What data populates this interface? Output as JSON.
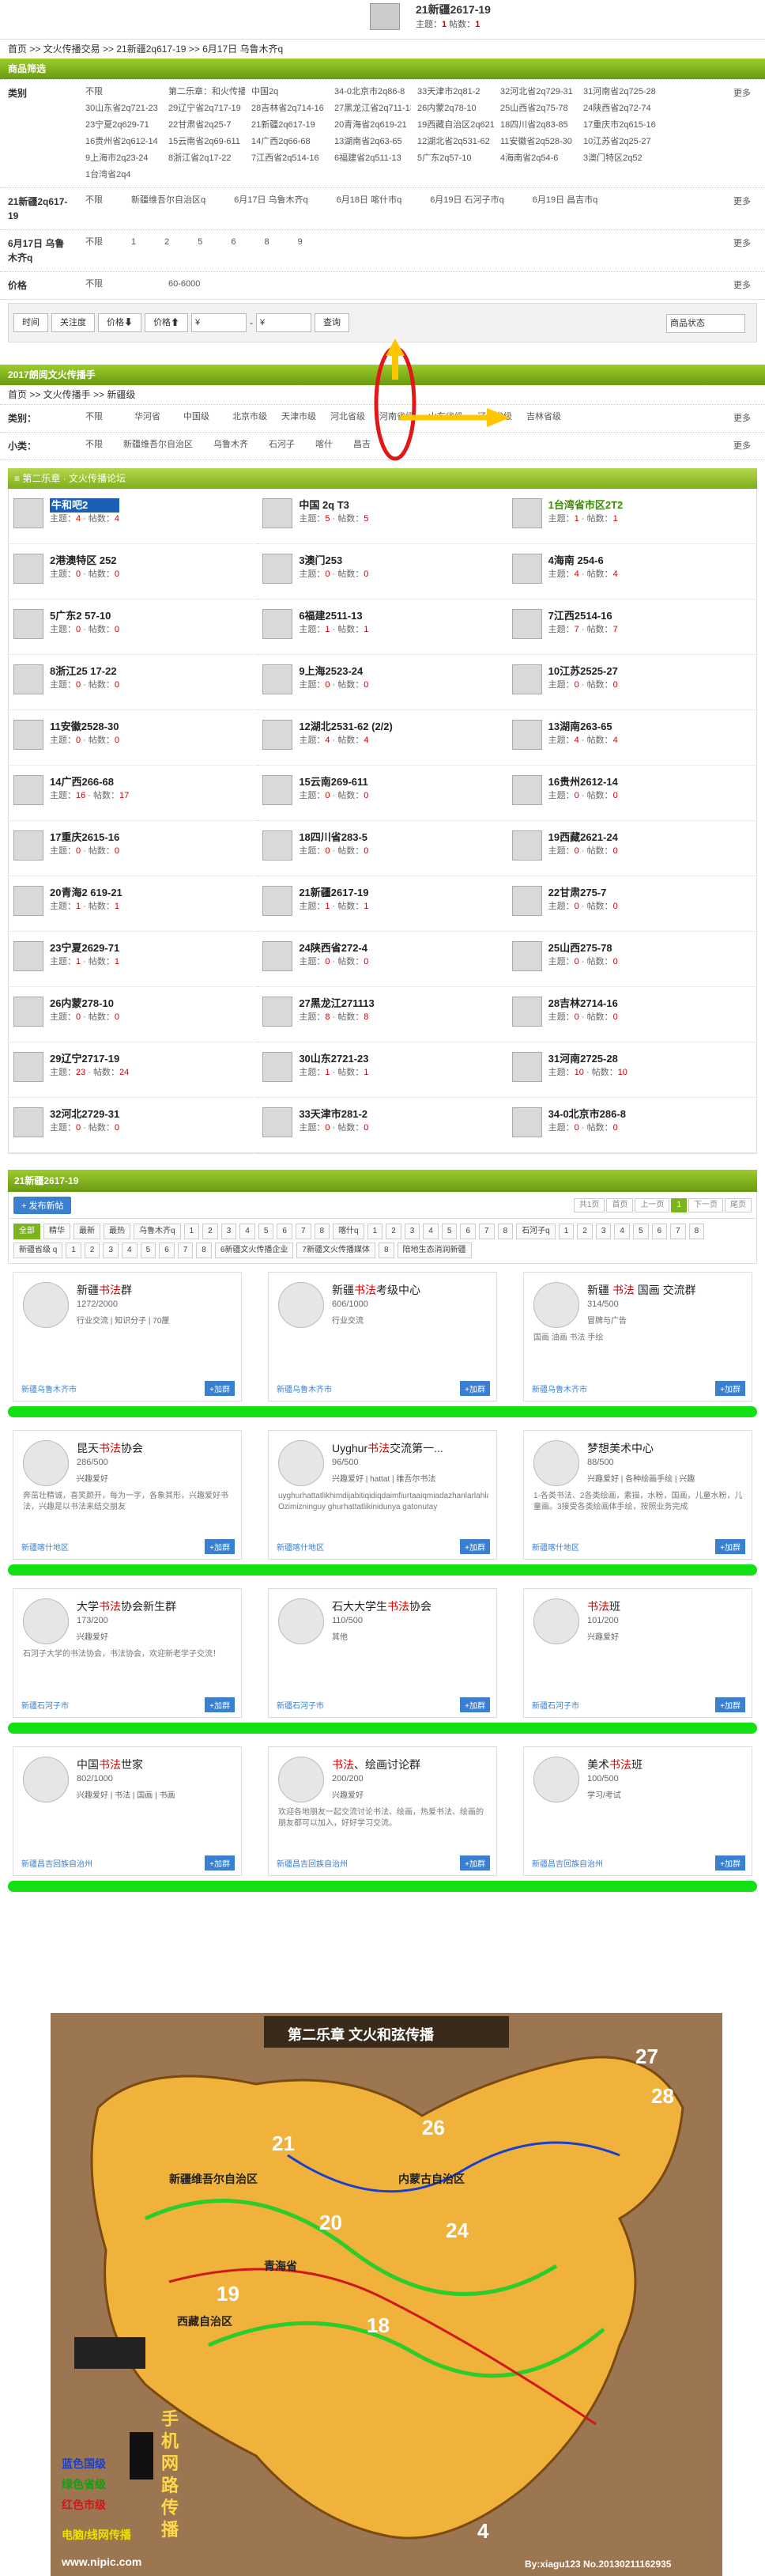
{
  "header": {
    "title": "21新疆2617-19",
    "stat_prefix": "主题：",
    "topics": "1",
    "stat_mid": " 帖数：",
    "posts": "1"
  },
  "breadcrumb": "首页 >> 文火传播交易 >> 21新疆2q617-19 >> 6月17日 乌鲁木齐q",
  "filter_title": "商品筛选",
  "filters": [
    {
      "label": "类别",
      "opts": [
        "不限",
        "第二乐章：和火传播",
        "中国2q",
        "34-0北京市2q86-8",
        "33天津市2q81-2",
        "32河北省2q729-31",
        "31河南省2q725-28",
        "30山东省2q721-23",
        "29辽宁省2q717-19",
        "28吉林省2q714-16",
        "27黑龙江省2q711-13",
        "26内蒙2q78-10",
        "25山西省2q75-78",
        "24陕西省2q72-74",
        "23宁夏2q629-71",
        "22甘肃省2q25-7",
        "21新疆2q617-19",
        "20青海省2q619-21",
        "19西藏自治区2q621-24",
        "18四川省2q83-85",
        "17重庆市2q615-16",
        "16贵州省2q612-14",
        "15云南省2q69-611",
        "14广西2q66-68",
        "13湖南省2q63-65",
        "12湖北省2q531-62",
        "11安徽省2q528-30",
        "10江苏省2q25-27",
        "9上海市2q23-24",
        "8浙江省2q17-22",
        "7江西省2q514-16",
        "6福建省2q511-13",
        "5广东2q57-10",
        "4海南省2q54-6",
        "3澳门特区2q52",
        "1台湾省2q4"
      ]
    },
    {
      "label": "21新疆2q617-19",
      "opts": [
        "不限",
        "新疆维吾尔自治区q",
        "6月17日 乌鲁木齐q",
        "6月18日 喀什市q",
        "6月19日 石河子市q",
        "6月19日 昌吉市q"
      ]
    },
    {
      "label": "6月17日 乌鲁木齐q",
      "opts": [
        "不限",
        "1",
        "2",
        "5",
        "6",
        "8",
        "9"
      ]
    },
    {
      "label": "价格",
      "opts": [
        "不限",
        "60-6000"
      ]
    }
  ],
  "more": "更多",
  "sort": {
    "time": "时间",
    "attention": "关注度",
    "price": "价格⬇",
    "price2": "价格⬆",
    "from": "¥",
    "to": "¥",
    "search": "查询",
    "status": "商品状态"
  },
  "spread_title": "2017朗阅文火传播手",
  "crumb2": "首页 >> 文火传播手 >> 新疆级",
  "cat_label": "类别：",
  "cat_opts": [
    "不限",
    "华河省",
    "中国级",
    "北京市级",
    "天津市级",
    "河北省级",
    "河南省级",
    "山东省级",
    "辽宁省级",
    "吉林省级"
  ],
  "sub_label": "小类：",
  "sub_opts": [
    "不限",
    "新疆维吾尔自治区",
    "乌鲁木齐",
    "石河子",
    "喀什",
    "昌吉"
  ],
  "forum_header": "≡ 第二乐章 · 文火传播论坛",
  "forums": [
    {
      "name": "牛和吧2",
      "t": "4",
      "p": "4",
      "hl": true
    },
    {
      "name": "中国 2q T3",
      "t": "5",
      "p": "5"
    },
    {
      "name": "1台湾省市区2T2",
      "t": "1",
      "p": "1",
      "g": true
    },
    {
      "name": "2港澳特区 252",
      "t": "0",
      "p": "0"
    },
    {
      "name": "3澳门253",
      "t": "0",
      "p": "0"
    },
    {
      "name": "4海南 254-6",
      "t": "4",
      "p": "4"
    },
    {
      "name": "5广东2 57-10",
      "t": "0",
      "p": "0"
    },
    {
      "name": "6福建2511-13",
      "t": "1",
      "p": "1"
    },
    {
      "name": "7江西2514-16",
      "t": "7",
      "p": "7"
    },
    {
      "name": "8浙江25 17-22",
      "t": "0",
      "p": "0"
    },
    {
      "name": "9上海2523-24",
      "t": "0",
      "p": "0"
    },
    {
      "name": "10江苏2525-27",
      "t": "0",
      "p": "0"
    },
    {
      "name": "11安徽2528-30",
      "t": "0",
      "p": "0"
    },
    {
      "name": "12湖北2531-62 (2/2)",
      "t": "4",
      "p": "4"
    },
    {
      "name": "13湖南263-65",
      "t": "4",
      "p": "4"
    },
    {
      "name": "14广西266-68",
      "t": "16",
      "p": "17"
    },
    {
      "name": "15云南269-611",
      "t": "0",
      "p": "0"
    },
    {
      "name": "16贵州2612-14",
      "t": "0",
      "p": "0"
    },
    {
      "name": "17重庆2615-16",
      "t": "0",
      "p": "0"
    },
    {
      "name": "18四川省283-5",
      "t": "0",
      "p": "0"
    },
    {
      "name": "19西藏2621-24",
      "t": "0",
      "p": "0"
    },
    {
      "name": "20青海2 619-21",
      "t": "1",
      "p": "1"
    },
    {
      "name": "21新疆2617-19",
      "t": "1",
      "p": "1"
    },
    {
      "name": "22甘肃275-7",
      "t": "0",
      "p": "0"
    },
    {
      "name": "23宁夏2629-71",
      "t": "1",
      "p": "1"
    },
    {
      "name": "24陕西省272-4",
      "t": "0",
      "p": "0"
    },
    {
      "name": "25山西275-78",
      "t": "0",
      "p": "0"
    },
    {
      "name": "26内蒙278-10",
      "t": "0",
      "p": "0"
    },
    {
      "name": "27黑龙江271113",
      "t": "8",
      "p": "8"
    },
    {
      "name": "28吉林2714-16",
      "t": "0",
      "p": "0"
    },
    {
      "name": "29辽宁2717-19",
      "t": "23",
      "p": "24"
    },
    {
      "name": "30山东2721-23",
      "t": "1",
      "p": "1"
    },
    {
      "name": "31河南2725-28",
      "t": "10",
      "p": "10"
    },
    {
      "name": "32河北2729-31",
      "t": "0",
      "p": "0"
    },
    {
      "name": "33天津市281-2",
      "t": "0",
      "p": "0"
    },
    {
      "name": "34-0北京市286-8",
      "t": "0",
      "p": "0"
    }
  ],
  "topic_label": "主题：",
  "post_label": "帖数：",
  "listing_title": "21新疆2617-19",
  "post_btn": "+ 发布新帖",
  "pager": [
    "共1页",
    "首页",
    "上一页",
    "1",
    "下一页",
    "尾页"
  ],
  "tabs": [
    "全部",
    "精华",
    "最新",
    "最热",
    "乌鲁木齐q",
    "1",
    "2",
    "3",
    "4",
    "5",
    "6",
    "7",
    "8",
    "喀什q",
    "1",
    "2",
    "3",
    "4",
    "5",
    "6",
    "7",
    "8",
    "石河子q",
    "1",
    "2",
    "3",
    "4",
    "5",
    "6",
    "7",
    "8",
    "新疆省级 q",
    "1",
    "2",
    "3",
    "4",
    "5",
    "6",
    "7",
    "8",
    "6新疆文火传播企业",
    "7新疆文火传播媒体",
    "8",
    "陪地生态消润新疆"
  ],
  "groups": [
    [
      {
        "pre": "新疆",
        "red": "书法",
        "post": "群",
        "m": "1272/2000",
        "t": "行业交流 | 知识分子 | 70厘",
        "d": "",
        "l": "新疆乌鲁木齐市"
      },
      {
        "pre": "新疆",
        "red": "书法",
        "post": "考级中心",
        "m": "606/1000",
        "t": "行业交流",
        "d": "",
        "l": "新疆乌鲁木齐市"
      },
      {
        "pre": "新疆 ",
        "red": "书法",
        "post": " 国画 交流群",
        "m": "314/500",
        "t": "冒牌与广告",
        "d": "国画 油画 书法 手绘",
        "l": "新疆乌鲁木齐市"
      }
    ],
    [
      {
        "pre": "昆天",
        "red": "书法",
        "post": "协会",
        "m": "286/500",
        "t": "兴趣爱好",
        "d": "奔茁壮精诚，喜笑颜开，每为一字，各象其形，兴趣爱好书法，兴趣是以书法来结交朋友",
        "l": "新疆喀什地区"
      },
      {
        "pre": "Uyghur",
        "red": "书法",
        "post": "交流第一...",
        "m": "96/500",
        "t": "兴趣爱好 | hattat | 维吾尔书法",
        "d": "uyghurhattatlikhimdijabitiqidiqdaimfiurtaaiqmiadazhanlarlahla Ozimizninguy ghurhattatlikinidunya gatonutay",
        "l": "新疆喀什地区"
      },
      {
        "pre": "梦想美术中心",
        "red": "",
        "post": "",
        "m": "88/500",
        "t": "兴趣爱好 | 各种绘画手绘 | 兴趣",
        "d": "1-各类书法、2各类绘画，素描，水粉，国画，儿童水粉，儿童画。3接受各类绘画体手绘，按照业务完成",
        "l": "新疆喀什地区"
      }
    ],
    [
      {
        "pre": "大学",
        "red": "书法",
        "post": "协会新生群",
        "m": "173/200",
        "t": "兴趣爱好",
        "d": "石河子大学的书法协会，书法协会，欢迎新老学子交流！",
        "l": "新疆石河子市"
      },
      {
        "pre": "石大大学生",
        "red": "书法",
        "post": "协会",
        "m": "110/500",
        "t": "其他",
        "d": "",
        "l": "新疆石河子市"
      },
      {
        "pre": "",
        "red": "书法",
        "post": "班",
        "m": "101/200",
        "t": "兴趣爱好",
        "d": "",
        "l": "新疆石河子市"
      }
    ],
    [
      {
        "pre": "中国",
        "red": "书法",
        "post": "世家",
        "m": "802/1000",
        "t": "兴趣爱好 | 书法 | 国画 | 书画",
        "d": "",
        "l": "新疆昌吉回族自治州"
      },
      {
        "pre": "",
        "red": "书法",
        "post": "、绘画讨论群",
        "m": "200/200",
        "t": "兴趣爱好",
        "d": "欢迎各地朋友一起交流讨论书法、绘画，热爱书法、绘画的朋友都可以加入，好好学习交流。",
        "l": "新疆昌吉回族自治州"
      },
      {
        "pre": "美术",
        "red": "书法",
        "post": "班",
        "m": "100/500",
        "t": "学习/考试",
        "d": "",
        "l": "新疆昌吉回族自治州"
      }
    ]
  ],
  "join": "+加群",
  "map": {
    "title": "第二乐章  文火和弦传播",
    "legend": [
      "蓝色国级",
      "绿色省级",
      "红色市级",
      "电脑/线网传播"
    ],
    "side": [
      "手机",
      "网路",
      "传播"
    ],
    "credit": "www.nipic.com",
    "by": "By:xiagu123 No.20130211162935",
    "labels": [
      "新疆维吾尔自治区",
      "西藏自治区",
      "青海省",
      "内蒙古自治区",
      "21",
      "19",
      "20",
      "18",
      "26",
      "28",
      "27",
      "24",
      "4"
    ]
  }
}
